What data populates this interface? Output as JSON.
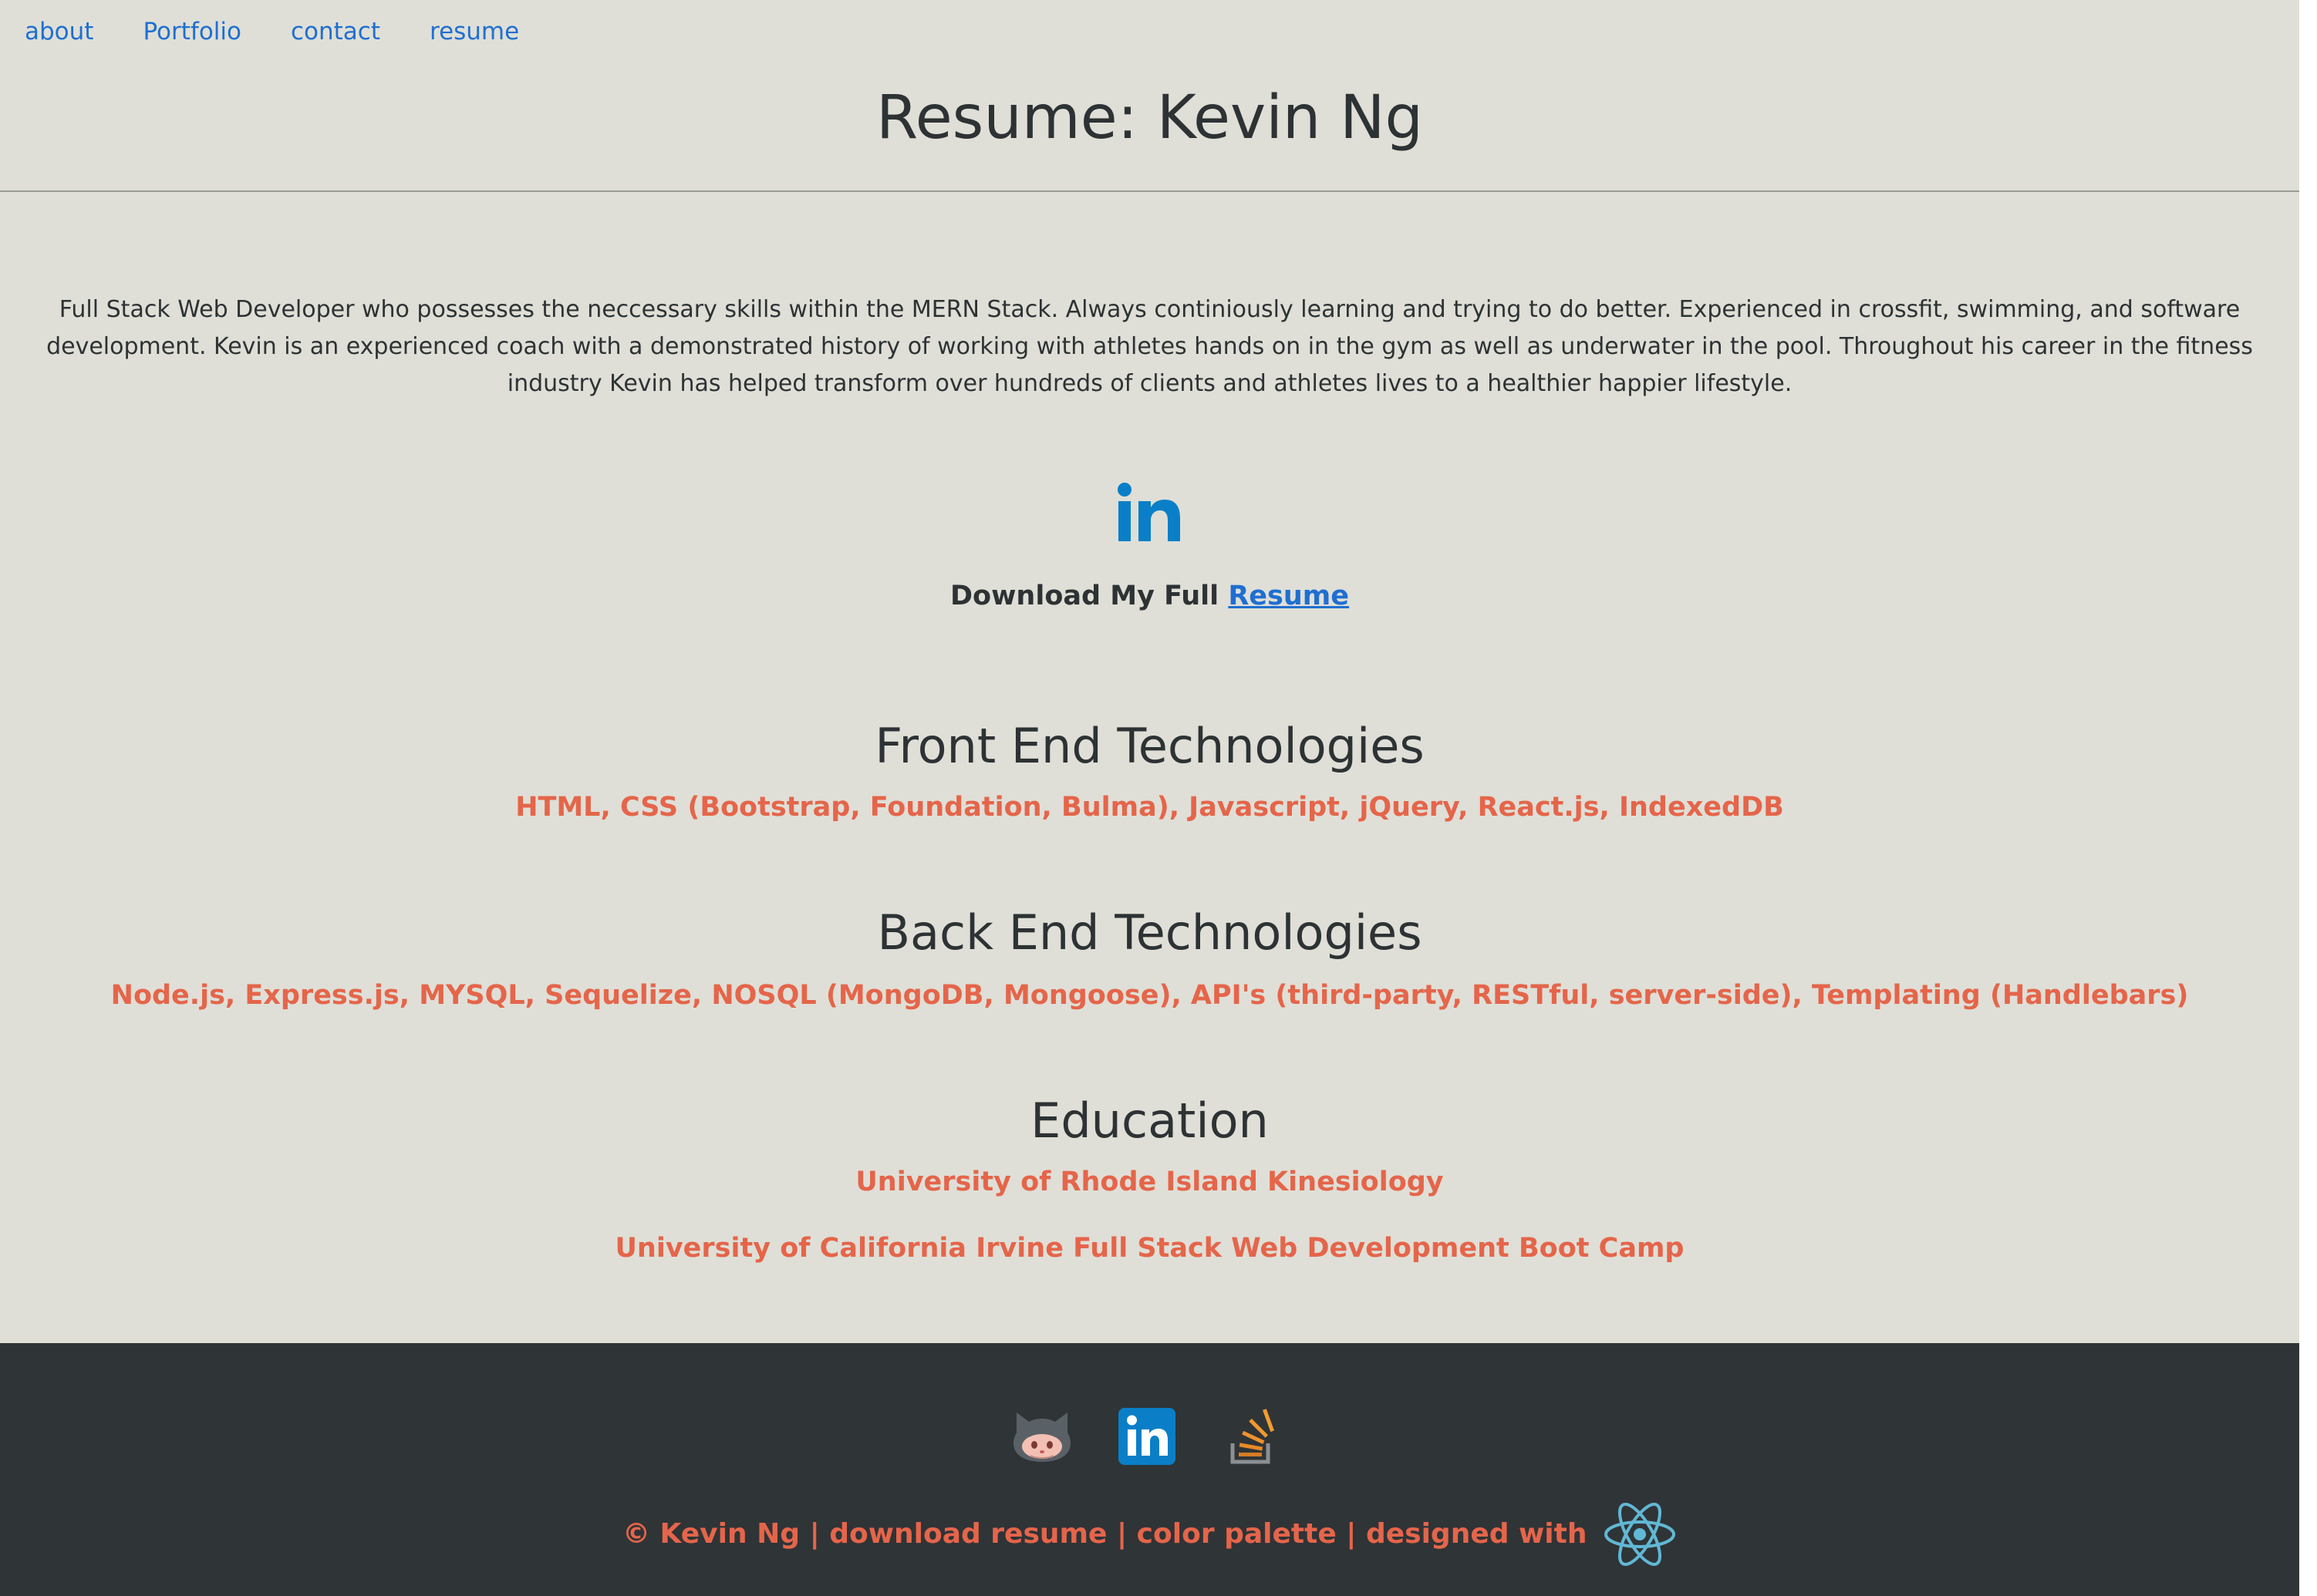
{
  "nav": {
    "items": [
      "about",
      "Portfolio",
      "contact",
      "resume"
    ]
  },
  "header": {
    "title": "Resume: Kevin Ng"
  },
  "bio": {
    "text": "Full Stack Web Developer who possesses the neccessary skills within the MERN Stack. Always continiously learning and trying to do better. Experienced in crossfit, swimming, and software development. Kevin is an experienced coach with a demonstrated history of working with athletes hands on in the gym as well as underwater in the pool. Throughout his career in the fitness industry Kevin has helped transform over hundreds of clients and athletes lives to a healthier happier lifestyle."
  },
  "linkedin_icon": "linkedin-icon",
  "download": {
    "prefix": "Download My Full ",
    "link_label": "Resume"
  },
  "sections": {
    "frontend": {
      "heading": "Front End Technologies",
      "body": "HTML, CSS (Bootstrap, Foundation, Bulma), Javascript, jQuery, React.js, IndexedDB"
    },
    "backend": {
      "heading": "Back End Technologies",
      "body": "Node.js, Express.js, MYSQL, Sequelize, NOSQL (MongoDB, Mongoose), API's (third-party, RESTful, server-side), Templating (Handlebars)"
    },
    "education": {
      "heading": "Education",
      "items": [
        "University of Rhode Island Kinesiology",
        "University of California Irvine Full Stack Web Development Boot Camp"
      ]
    }
  },
  "footer": {
    "icons": [
      "github-icon",
      "linkedin-icon",
      "stackoverflow-icon",
      "react-icon"
    ],
    "text": "© Kevin Ng | download resume | color palette | designed with"
  },
  "colors": {
    "background": "#dfdfd7",
    "footer": "#2f3437",
    "accent": "#e5654a",
    "link": "#1f6fd1",
    "text": "#2d3234"
  }
}
